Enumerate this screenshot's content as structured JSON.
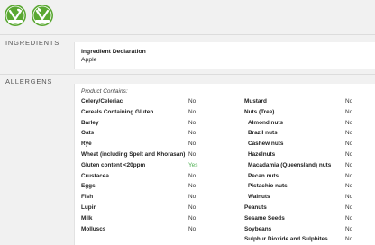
{
  "colors": {
    "badge_green": "#5aa832",
    "yes_green": "#4caf50",
    "panel_bg": "#ffffff",
    "page_bg": "#f1f1f1"
  },
  "badges": [
    {
      "icon": "vegetarian-badge-icon"
    },
    {
      "icon": "vegan-badge-icon"
    }
  ],
  "sections": {
    "ingredients": "INGREDIENTS",
    "allergens": "ALLERGENS"
  },
  "ingredients": {
    "title": "Ingredient Declaration",
    "value": "Apple"
  },
  "allergens": {
    "intro": "Product Contains:",
    "left": [
      {
        "name": "Celery/Celeriac",
        "value": "No"
      },
      {
        "name": "Cereals Containing Gluten",
        "value": "No"
      },
      {
        "name": "Barley",
        "value": "No"
      },
      {
        "name": "Oats",
        "value": "No"
      },
      {
        "name": "Rye",
        "value": "No"
      },
      {
        "name": "Wheat (including Spelt and Khorasan)",
        "value": "No"
      },
      {
        "name": "Gluten content <20ppm",
        "value": "Yes"
      },
      {
        "name": "Crustacea",
        "value": "No"
      },
      {
        "name": "Eggs",
        "value": "No"
      },
      {
        "name": "Fish",
        "value": "No"
      },
      {
        "name": "Lupin",
        "value": "No"
      },
      {
        "name": "Milk",
        "value": "No"
      },
      {
        "name": "Molluscs",
        "value": "No"
      }
    ],
    "right": [
      {
        "name": "Mustard",
        "value": "No",
        "sub": false
      },
      {
        "name": "Nuts (Tree)",
        "value": "No",
        "sub": false
      },
      {
        "name": "Almond nuts",
        "value": "No",
        "sub": true
      },
      {
        "name": "Brazil nuts",
        "value": "No",
        "sub": true
      },
      {
        "name": "Cashew nuts",
        "value": "No",
        "sub": true
      },
      {
        "name": "Hazelnuts",
        "value": "No",
        "sub": true
      },
      {
        "name": "Macadamia (Queensland) nuts",
        "value": "No",
        "sub": true
      },
      {
        "name": "Pecan nuts",
        "value": "No",
        "sub": true
      },
      {
        "name": "Pistachio nuts",
        "value": "No",
        "sub": true
      },
      {
        "name": "Walnuts",
        "value": "No",
        "sub": true
      },
      {
        "name": "Peanuts",
        "value": "No",
        "sub": false
      },
      {
        "name": "Sesame Seeds",
        "value": "No",
        "sub": false
      },
      {
        "name": "Soybeans",
        "value": "No",
        "sub": false
      },
      {
        "name": "Sulphur Dioxide and Sulphites",
        "value": "No",
        "sub": false
      }
    ]
  }
}
